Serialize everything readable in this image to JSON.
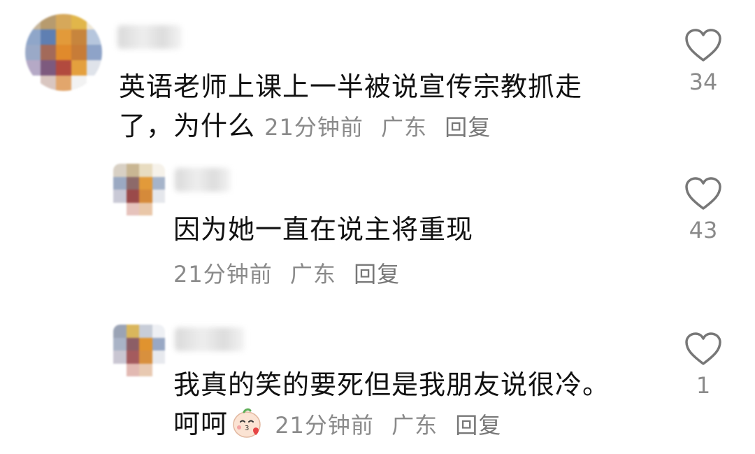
{
  "comments": [
    {
      "text_line1": "英语老师上课上一半被说宣传宗教抓走",
      "text_line2": "了，为什么",
      "time": "21分钟前",
      "location": "广东",
      "reply_label": "回复",
      "likes": "34"
    },
    {
      "text_line1": "因为她一直在说主将重现",
      "time": "21分钟前",
      "location": "广东",
      "reply_label": "回复",
      "likes": "43"
    },
    {
      "text_line1": "我真的笑的要死但是我朋友说很冷。",
      "text_line2": "呵呵",
      "emoji": "kiss-face-emoji",
      "time": "21分钟前",
      "location": "广东",
      "reply_label": "回复",
      "likes": "1"
    }
  ],
  "icons": {
    "like": "heart-outline-icon"
  },
  "colors": {
    "text": "#111111",
    "meta": "#8a8a8a",
    "icon": "#777777"
  }
}
